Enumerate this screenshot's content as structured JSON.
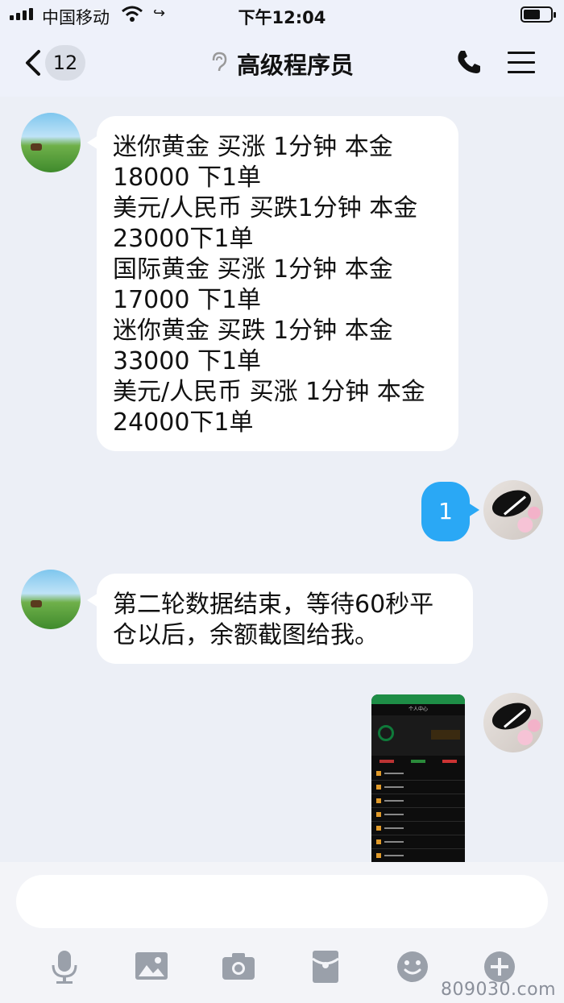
{
  "status_bar": {
    "carrier": "中国移动",
    "time": "下午12:04"
  },
  "nav": {
    "back_count": "12",
    "title": "高级程序员",
    "icons": [
      "back-chevron-icon",
      "ear-icon",
      "phone-icon",
      "menu-icon"
    ]
  },
  "messages": [
    {
      "side": "left",
      "lines": [
        "迷你黄金 买涨 1分钟 本金",
        "18000 下1单",
        "美元/人民币 买跌1分钟 本金",
        "23000下1单",
        "国际黄金 买涨 1分钟 本金",
        "17000 下1单",
        "迷你黄金 买跌 1分钟 本金",
        "33000 下1单",
        "美元/人民币 买涨 1分钟 本金",
        "24000下1单"
      ]
    },
    {
      "side": "right",
      "text": "1"
    },
    {
      "side": "left",
      "lines": [
        "第二轮数据结束，等待60秒平",
        "仓以后，余额截图给我。"
      ]
    },
    {
      "side": "right",
      "type": "image",
      "title": "个人中心"
    }
  ],
  "toolbar": {
    "icons": [
      "microphone-icon",
      "image-icon",
      "camera-icon",
      "red-packet-icon",
      "emoji-icon",
      "plus-icon"
    ]
  },
  "watermark": "809030.com"
}
